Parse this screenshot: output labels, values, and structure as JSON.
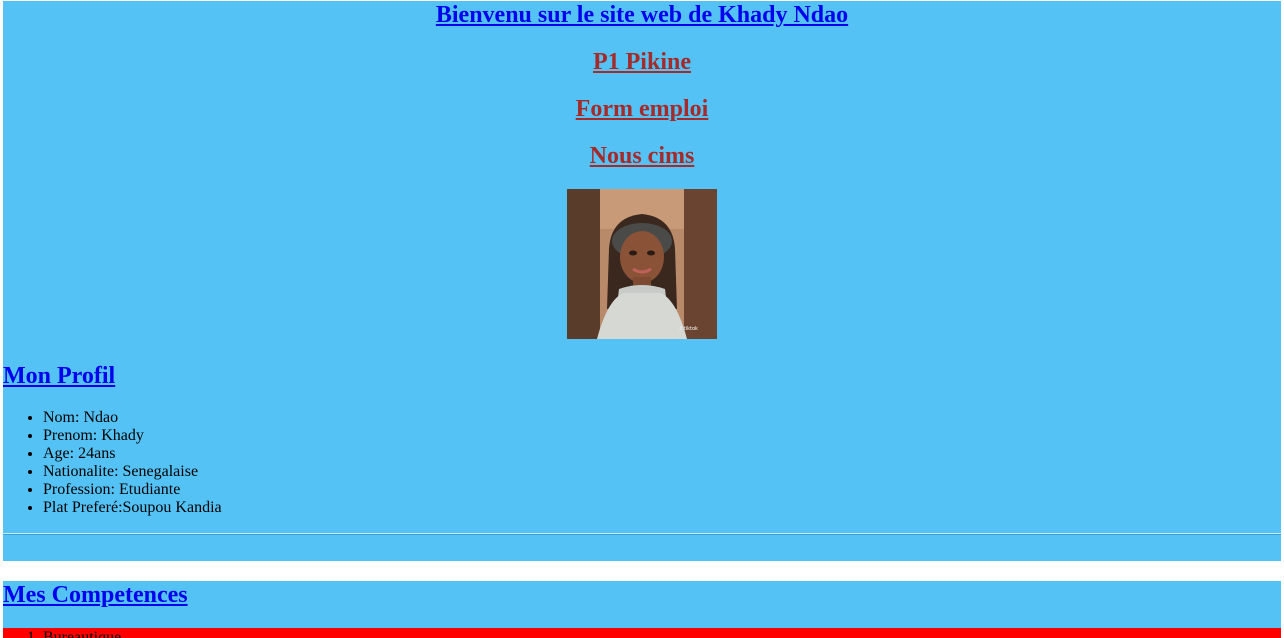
{
  "header": {
    "welcome_link": "Bienvenu sur le site web de Khady Ndao",
    "nav_links": [
      "P1 Pikine",
      "Form emploi",
      "Nous cims"
    ]
  },
  "profile": {
    "title": "Mon Profil",
    "photo": "portrait-photo",
    "items": [
      "Nom: Ndao",
      "Prenom: Khady",
      "Age: 24ans",
      "Nationalite: Senegalaise",
      "Profession: Etudiante",
      "Plat Preferé:Soupou Kandia"
    ]
  },
  "skills": {
    "title": "Mes Competences",
    "items": [
      "Bureautique"
    ]
  },
  "colors": {
    "panel": "#55c2f5",
    "link_blue": "#0000ee",
    "link_maroon": "#a52a2a",
    "strip_red": "#ff0000"
  }
}
